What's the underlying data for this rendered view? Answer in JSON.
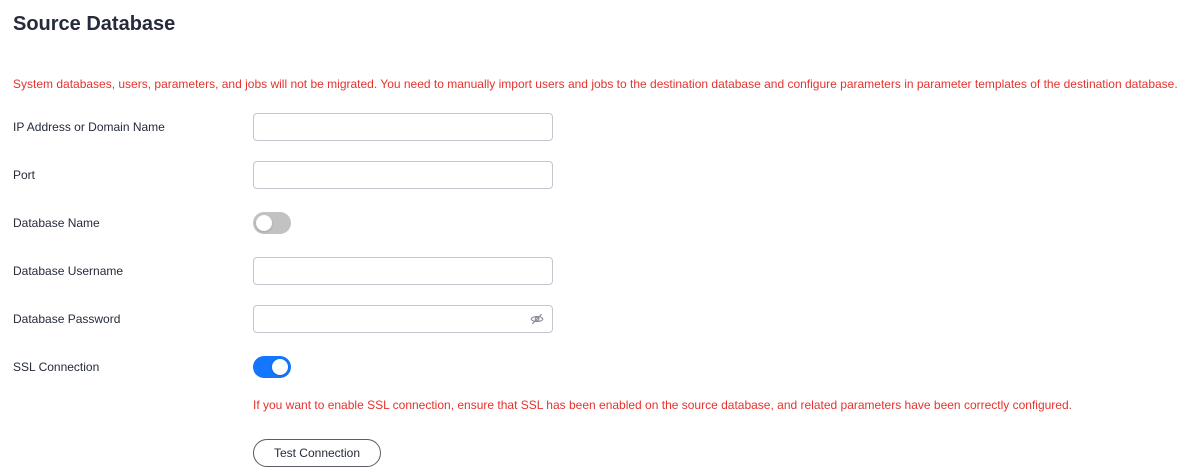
{
  "page": {
    "title": "Source Database",
    "notice": "System databases, users, parameters, and jobs will not be migrated. You need to manually import users and jobs to the destination database and configure parameters in parameter templates of the destination database."
  },
  "form": {
    "ip_address": {
      "label": "IP Address or Domain Name",
      "value": ""
    },
    "port": {
      "label": "Port",
      "value": ""
    },
    "database_name": {
      "label": "Database Name",
      "enabled": false
    },
    "database_username": {
      "label": "Database Username",
      "value": ""
    },
    "database_password": {
      "label": "Database Password",
      "value": "",
      "visibility_icon": "eye-slash-icon"
    },
    "ssl_connection": {
      "label": "SSL Connection",
      "enabled": true,
      "hint": "If you want to enable SSL connection, ensure that SSL has been enabled on the source database, and related parameters have been correctly configured."
    }
  },
  "actions": {
    "test_connection_label": "Test Connection"
  },
  "colors": {
    "accent": "#1476ff",
    "error": "#e5332e",
    "text": "#252b3a",
    "input_border": "#c3c6cd",
    "switch_off": "#c2c2c2"
  }
}
